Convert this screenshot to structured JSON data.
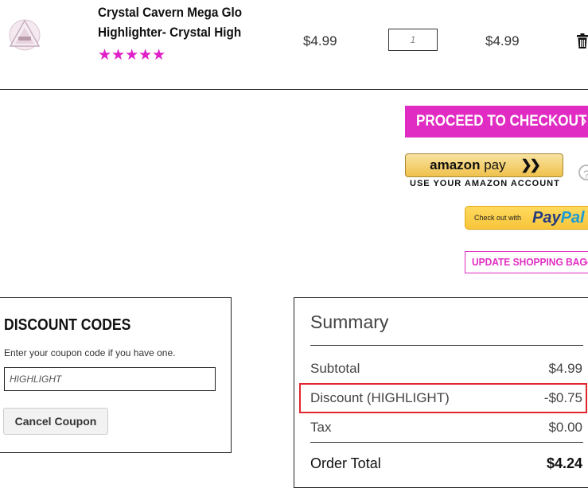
{
  "cart_item": {
    "name_line1": "Crystal Cavern Mega Glo",
    "name_line2": "Highlighter- Crystal High",
    "rating_stars": "★★★★★",
    "unit_price": "$4.99",
    "quantity": "1",
    "line_total": "$4.99",
    "thumbnail": "highlighter-product-image",
    "delete_icon": "trash-icon"
  },
  "checkout": {
    "proceed_label": "PROCEED TO CHECKOUT",
    "amazon_pay_brand": "amazon",
    "amazon_pay_word": "pay",
    "amazon_pay_sub": "USE YOUR AMAZON ACCOUNT",
    "help_glyph": "?",
    "paypal_prefix": "Check out with",
    "paypal_pay": "Pay",
    "paypal_pal": "Pal",
    "update_label": "UPDATE SHOPPING BAG"
  },
  "discount": {
    "title": "DISCOUNT CODES",
    "help_text": "Enter your coupon code if you have one.",
    "code_value": "HIGHLIGHT",
    "cancel_label": "Cancel Coupon"
  },
  "summary": {
    "title": "Summary",
    "subtotal_label": "Subtotal",
    "subtotal_value": "$4.99",
    "discount_label": "Discount (HIGHLIGHT)",
    "discount_value": "-$0.75",
    "tax_label": "Tax",
    "tax_value": "$0.00",
    "total_label": "Order Total",
    "total_value": "$4.24"
  },
  "colors": {
    "accent_magenta": "#e02cc2",
    "highlight_red": "#e0262e",
    "amazon_gold": "#f0c14b",
    "paypal_yellow": "#ffc439"
  }
}
